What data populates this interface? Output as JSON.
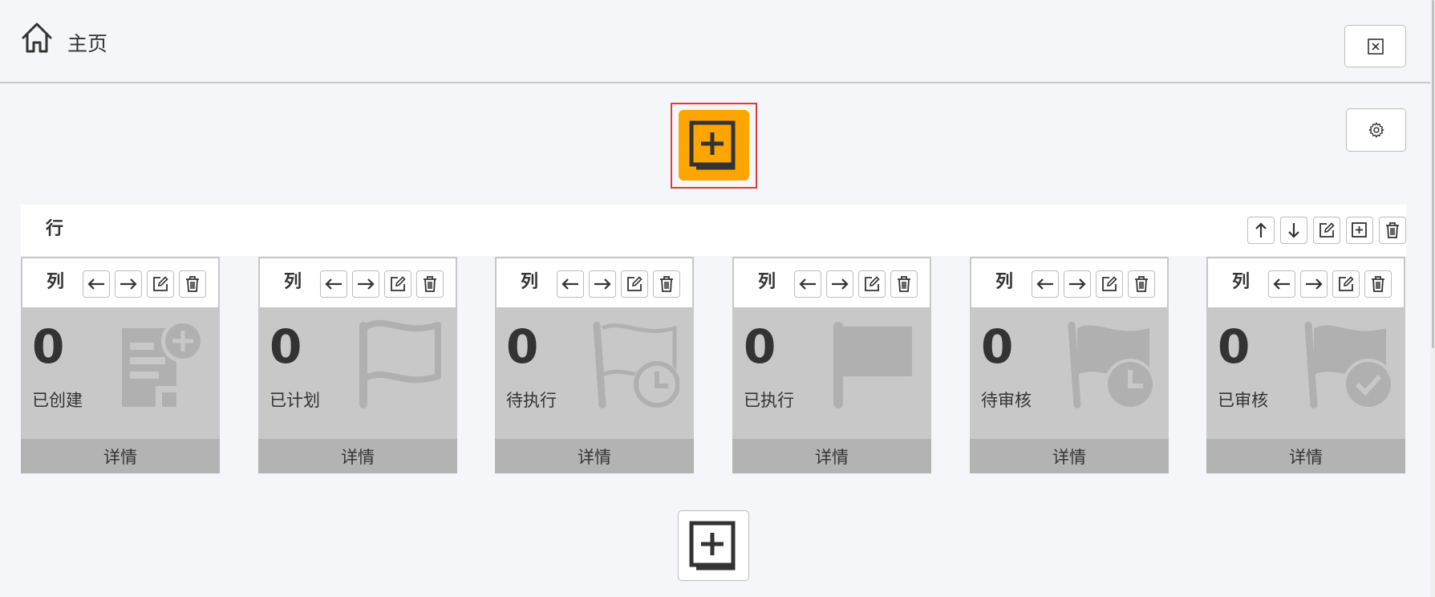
{
  "header": {
    "title": "主页",
    "home_icon": "home-icon",
    "close_icon": "close-square-icon"
  },
  "toolbar": {
    "settings_icon": "gear-icon",
    "add_top_icon": "add-square-icon",
    "add_bottom_icon": "add-square-icon",
    "accent_color": "#ffa500",
    "highlight_color": "#e03a3a"
  },
  "row": {
    "label": "行",
    "tools": [
      "arrow-up-icon",
      "arrow-down-icon",
      "edit-icon",
      "add-square-icon",
      "trash-icon"
    ]
  },
  "columns": [
    {
      "label": "列",
      "value": "0",
      "status": "已创建",
      "details": "详情",
      "icon": "document-add-icon"
    },
    {
      "label": "列",
      "value": "0",
      "status": "已计划",
      "details": "详情",
      "icon": "flag-outline-icon"
    },
    {
      "label": "列",
      "value": "0",
      "status": "待执行",
      "details": "详情",
      "icon": "flag-clock-outline-icon"
    },
    {
      "label": "列",
      "value": "0",
      "status": "已执行",
      "details": "详情",
      "icon": "flag-filled-icon"
    },
    {
      "label": "列",
      "value": "0",
      "status": "待审核",
      "details": "详情",
      "icon": "flag-clock-filled-icon"
    },
    {
      "label": "列",
      "value": "0",
      "status": "已审核",
      "details": "详情",
      "icon": "flag-check-icon"
    }
  ],
  "column_tools": [
    "arrow-left-icon",
    "arrow-right-icon",
    "edit-icon",
    "trash-icon"
  ],
  "colors": {
    "card_body": "#c8c8c8",
    "card_footer": "#b3b3b3",
    "icon_watermark": "#b0b0b0"
  }
}
